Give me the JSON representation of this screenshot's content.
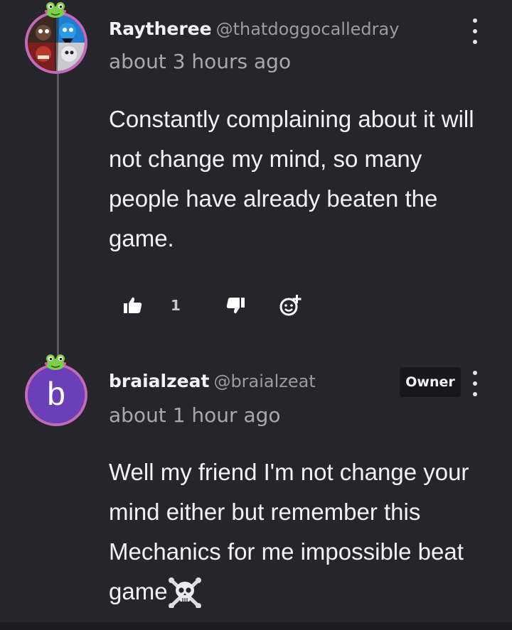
{
  "comments": [
    {
      "username": "Raytheree",
      "handle": "@thatdoggocalledray",
      "timestamp": "about 3 hours ago",
      "body": "Constantly complaining about it will not change my mind, so many people have already beaten the game.",
      "likes": "1",
      "avatar_icon": "character-collage-avatar",
      "badge_icon": "frog-badge-icon"
    },
    {
      "username": "braialzeat",
      "handle": "@braialzeat",
      "timestamp": "about 1 hour ago",
      "body": "Well my friend I'm not change your mind either but remember this Mechanics for me impossible beat game",
      "avatar_letter": "b",
      "role_badge": "Owner",
      "trailing_emoji": "skull-and-crossbones-icon",
      "badge_icon": "frog-badge-icon"
    }
  ],
  "colors": {
    "background": "#26252b",
    "avatar_ring": "#c26ab8",
    "letter_avatar": "#6b3fb8",
    "thread_line": "#5a5960"
  }
}
